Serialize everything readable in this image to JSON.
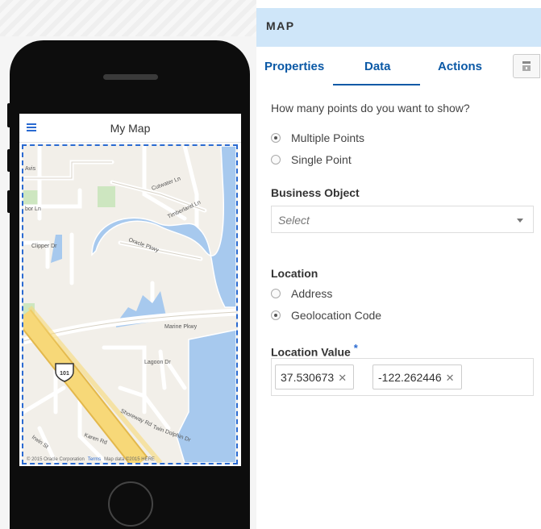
{
  "phone": {
    "app_title": "My Map",
    "map_footer": {
      "copyright": "© 2015 Oracle Corporation",
      "terms": "Terms",
      "map_data": "Map data ©2015 HERE"
    }
  },
  "panel": {
    "header": "MAP",
    "tabs": [
      {
        "label": "Properties"
      },
      {
        "label": "Data"
      },
      {
        "label": "Actions"
      }
    ],
    "active_tab": "Data",
    "question": "How many points do you want to show?",
    "points_options": [
      {
        "label": "Multiple Points",
        "selected": true
      },
      {
        "label": "Single Point",
        "selected": false
      }
    ],
    "business_object": {
      "label": "Business Object",
      "placeholder": "Select"
    },
    "location": {
      "label": "Location",
      "options": [
        {
          "label": "Address",
          "selected": false
        },
        {
          "label": "Geolocation Code",
          "selected": true
        }
      ]
    },
    "location_value": {
      "label": "Location Value",
      "required_mark": "*",
      "chips": [
        {
          "value": "37.530673",
          "remove": "✕"
        },
        {
          "value": "-122.262446",
          "remove": "✕"
        }
      ]
    }
  },
  "colors": {
    "accent": "#0b59a6",
    "header_bg": "#cfe6f9",
    "water": "#a7c9ee",
    "park": "#cde6c0",
    "highway": "#f7d878"
  }
}
